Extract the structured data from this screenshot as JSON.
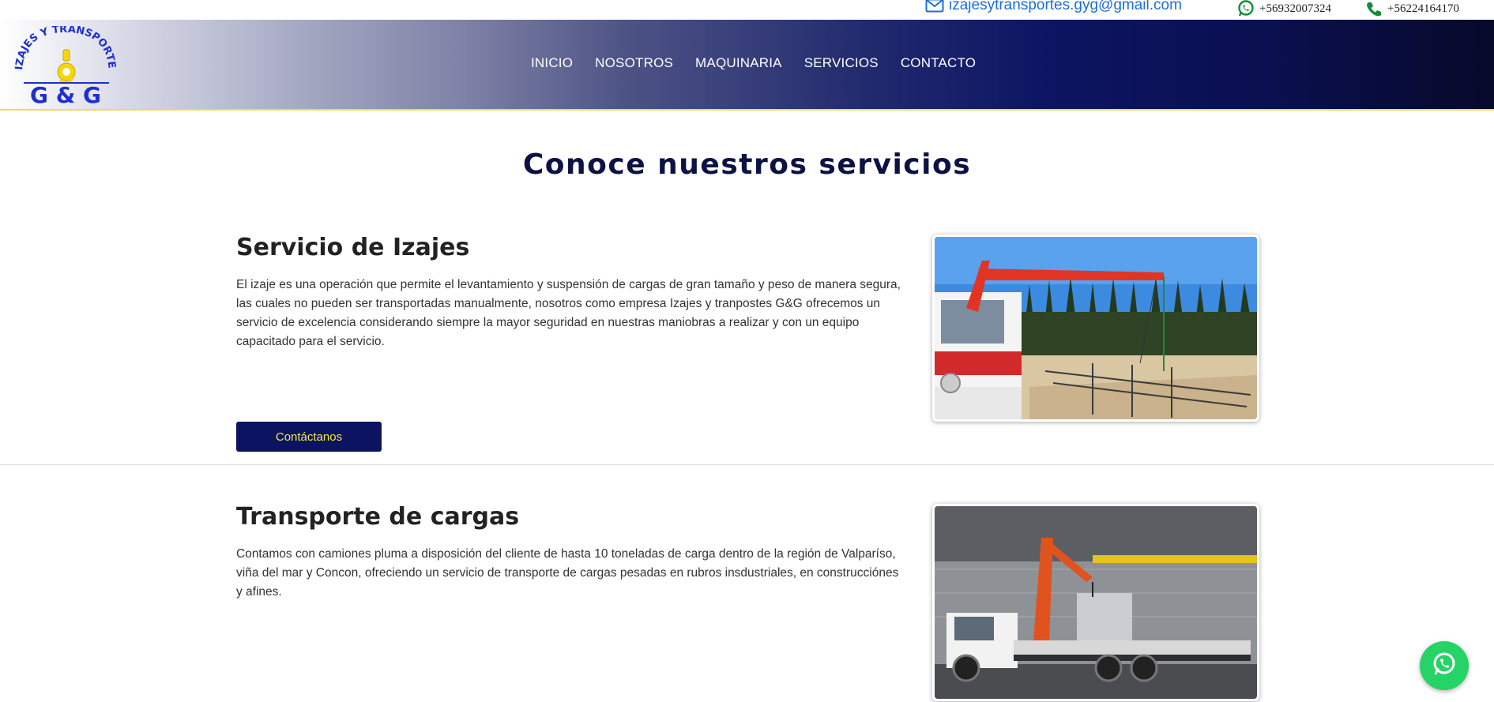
{
  "topbar": {
    "email": "izajesytransportes.gyg@gmail.com",
    "phone_whatsapp": "+56932007324",
    "phone_landline": "+56224164170",
    "icons": {
      "email": "mail-icon",
      "whatsapp": "whatsapp-icon",
      "phone": "phone-icon"
    }
  },
  "logo": {
    "arc_text": "IZAJES Y TRANSPORTES",
    "letters": "G & G"
  },
  "nav": {
    "items": [
      "INICIO",
      "NOSOTROS",
      "MAQUINARIA",
      "SERVICIOS",
      "CONTACTO"
    ]
  },
  "main": {
    "title": "Conoce nuestros servicios",
    "services": [
      {
        "title": "Servicio de Izajes",
        "description": "El izaje es una operación que permite el levantamiento y suspensión de cargas de gran tamaño y peso de manera segura, las cuales no pueden ser transportadas manualmente, nosotros como empresa Izajes y tranpostes G&G ofrecemos un servicio de excelencia considerando siempre la mayor seguridad en nuestras maniobras a realizar y con un equipo capacitado para el servicio.",
        "button": "Contáctanos"
      },
      {
        "title": "Transporte de cargas",
        "description": "Contamos con camiones pluma a disposición del cliente de hasta 10 toneladas de carga dentro de la región de Valparíso, viña del mar y Concon, ofreciendo un servicio de transporte de cargas pesadas en rubros insdustriales, en construcciónes y afines."
      }
    ]
  },
  "colors": {
    "brand_navy": "#0c1461",
    "brand_yellow": "#f2e94a",
    "email_blue": "#1a6fd8",
    "whatsapp_green": "#25d366"
  }
}
